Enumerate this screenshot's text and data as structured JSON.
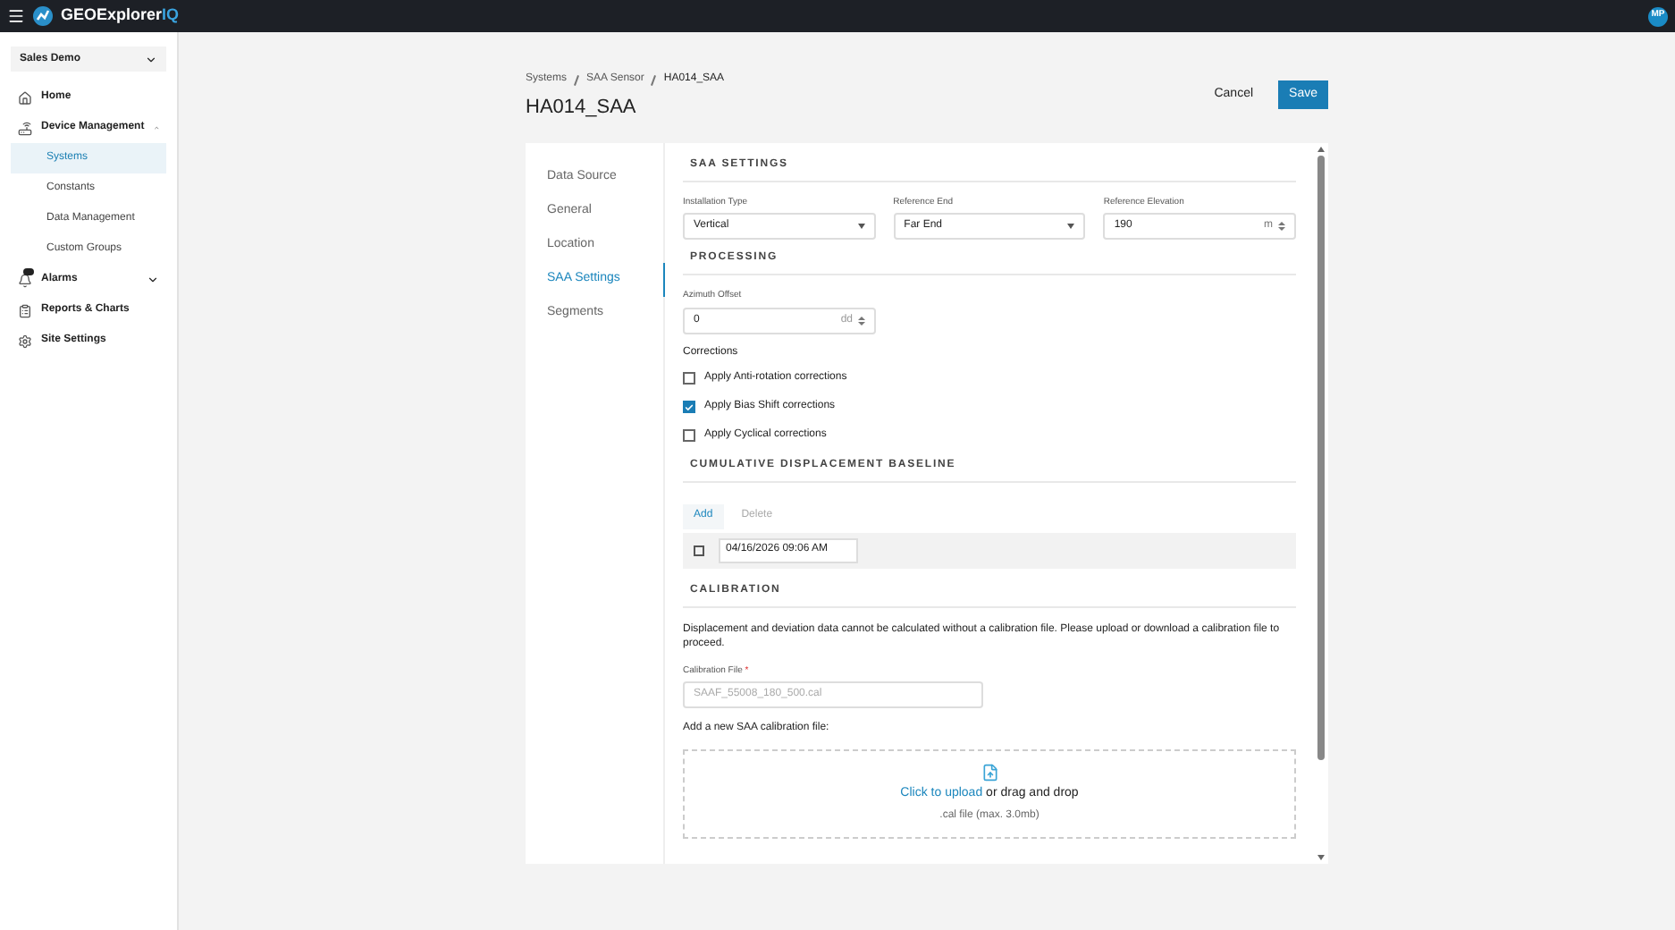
{
  "app": {
    "name": "GEOExplorer",
    "name_suffix": "IQ",
    "avatar": "MP"
  },
  "sidebar": {
    "org": "Sales Demo",
    "items": [
      {
        "label": "Home"
      },
      {
        "label": "Device Management",
        "expanded": true,
        "children": [
          {
            "label": "Systems",
            "selected": true
          },
          {
            "label": "Constants",
            "selected": false
          },
          {
            "label": "Data Management",
            "selected": false
          },
          {
            "label": "Custom Groups",
            "selected": false
          }
        ]
      },
      {
        "label": "Alarms",
        "expanded": false,
        "badge": true
      },
      {
        "label": "Reports & Charts"
      },
      {
        "label": "Site Settings"
      }
    ]
  },
  "breadcrumb": [
    "Systems",
    "SAA Sensor",
    "HA014_SAA"
  ],
  "title": "HA014_SAA",
  "actions": {
    "cancel": "Cancel",
    "save": "Save"
  },
  "tabs": [
    {
      "label": "Data Source",
      "selected": false
    },
    {
      "label": "General",
      "selected": false
    },
    {
      "label": "Location",
      "selected": false
    },
    {
      "label": "SAA Settings",
      "selected": true
    },
    {
      "label": "Segments",
      "selected": false
    }
  ],
  "saa_settings": {
    "heading": "SAA SETTINGS",
    "fields": [
      {
        "label": "Installation Type",
        "kind": "select",
        "value": "Vertical"
      },
      {
        "label": "Reference End",
        "kind": "select",
        "value": "Far End"
      },
      {
        "label": "Reference Elevation",
        "kind": "number",
        "value": "190",
        "unit": "m"
      }
    ]
  },
  "processing": {
    "heading": "PROCESSING",
    "azimuth": {
      "label": "Azimuth Offset",
      "value": "0",
      "unit": "dd"
    },
    "corrections_label": "Corrections",
    "corrections": [
      {
        "label": "Apply Anti-rotation corrections",
        "checked": false
      },
      {
        "label": "Apply Bias Shift corrections",
        "checked": true
      },
      {
        "label": "Apply Cyclical corrections",
        "checked": false
      }
    ]
  },
  "baseline": {
    "heading": "CUMULATIVE DISPLACEMENT BASELINE",
    "add": "Add",
    "delete": "Delete",
    "rows": [
      {
        "date": "04/16/2026 09:06 AM",
        "checked": false
      }
    ]
  },
  "calibration": {
    "heading": "CALIBRATION",
    "message": "Displacement and deviation data cannot be calculated without a calibration file. Please upload or download a calibration file to proceed.",
    "file_label": "Calibration File",
    "required": "*",
    "file_placeholder": "SAAF_55008_180_500.cal",
    "add_label": "Add a new SAA calibration file:",
    "upload_link": "Click to upload",
    "upload_text": "or drag and drop",
    "upload_hint": ".cal file (max. 3.0mb)"
  }
}
